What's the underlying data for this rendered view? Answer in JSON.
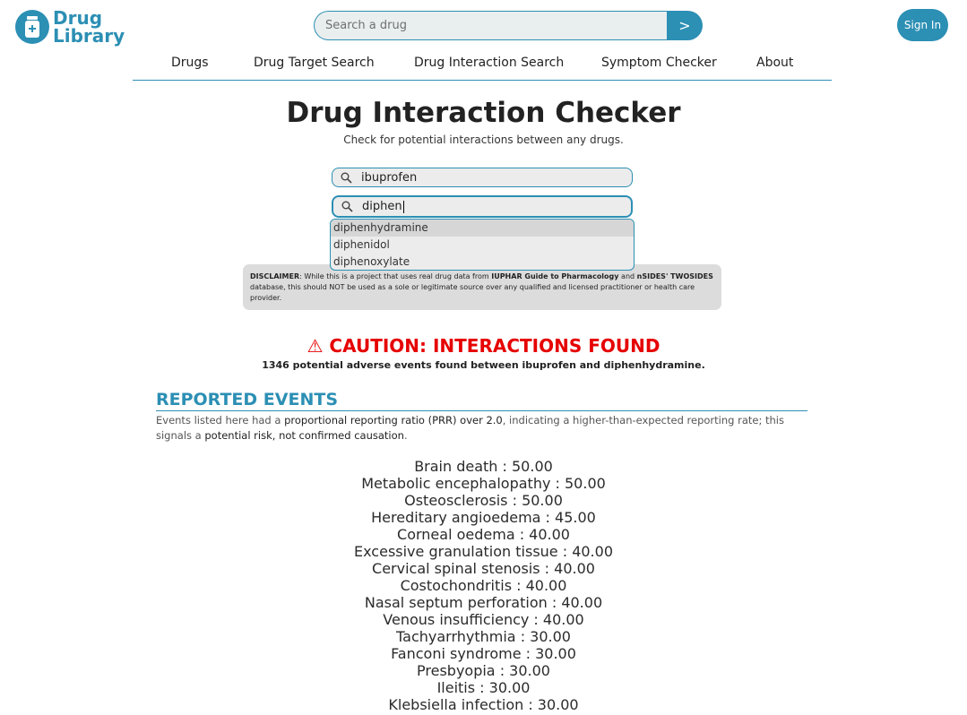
{
  "header": {
    "logo_line1": "Drug",
    "logo_line2": "Library",
    "search_placeholder": "Search a drug",
    "search_button": ">",
    "signin_label": "Sign In"
  },
  "nav": {
    "items": [
      "Drugs",
      "Drug Target Search",
      "Drug Interaction Search",
      "Symptom Checker",
      "About"
    ]
  },
  "main": {
    "title": "Drug Interaction Checker",
    "subtitle": "Check for potential interactions between any drugs.",
    "drug1_value": "ibuprofen",
    "drug2_value": "diphen",
    "suggestions": [
      "diphenhydramine",
      "diphenidol",
      "diphenoxylate"
    ],
    "disclaimer": {
      "label": "DISCLAIMER",
      "text1": ": While this is a project that uses real drug data from ",
      "source1": "IUPHAR Guide to Pharmacology",
      "text2": " and ",
      "source2": "nSIDES' TWOSIDES",
      "text3": " database, this should NOT be used as a sole or legitimate source over any qualified and licensed practitioner or health care provider."
    },
    "caution_icon": "⚠",
    "caution": "CAUTION: INTERACTIONS FOUND",
    "events_count": "1346 potential adverse events found between ibuprofen and diphenhydramine."
  },
  "reported": {
    "heading": "REPORTED EVENTS",
    "text1": "Events listed here had a ",
    "em1": "proportional reporting ratio (PRR) over 2.0",
    "text2": ", indicating a higher-than-expected reporting rate; this signals a ",
    "em2": "potential risk, not confirmed causation",
    "text3": ".",
    "events": [
      "Brain death : 50.00",
      "Metabolic encephalopathy : 50.00",
      "Osteosclerosis : 50.00",
      "Hereditary angioedema : 45.00",
      "Corneal oedema : 40.00",
      "Excessive granulation tissue : 40.00",
      "Cervical spinal stenosis : 40.00",
      "Costochondritis : 40.00",
      "Nasal septum perforation : 40.00",
      "Venous insufficiency : 40.00",
      "Tachyarrhythmia : 30.00",
      "Fanconi syndrome : 30.00",
      "Presbyopia : 30.00",
      "Ileitis : 30.00",
      "Klebsiella infection : 30.00"
    ]
  },
  "colors": {
    "accent": "#2c8fb4",
    "caution": "#e60000"
  }
}
